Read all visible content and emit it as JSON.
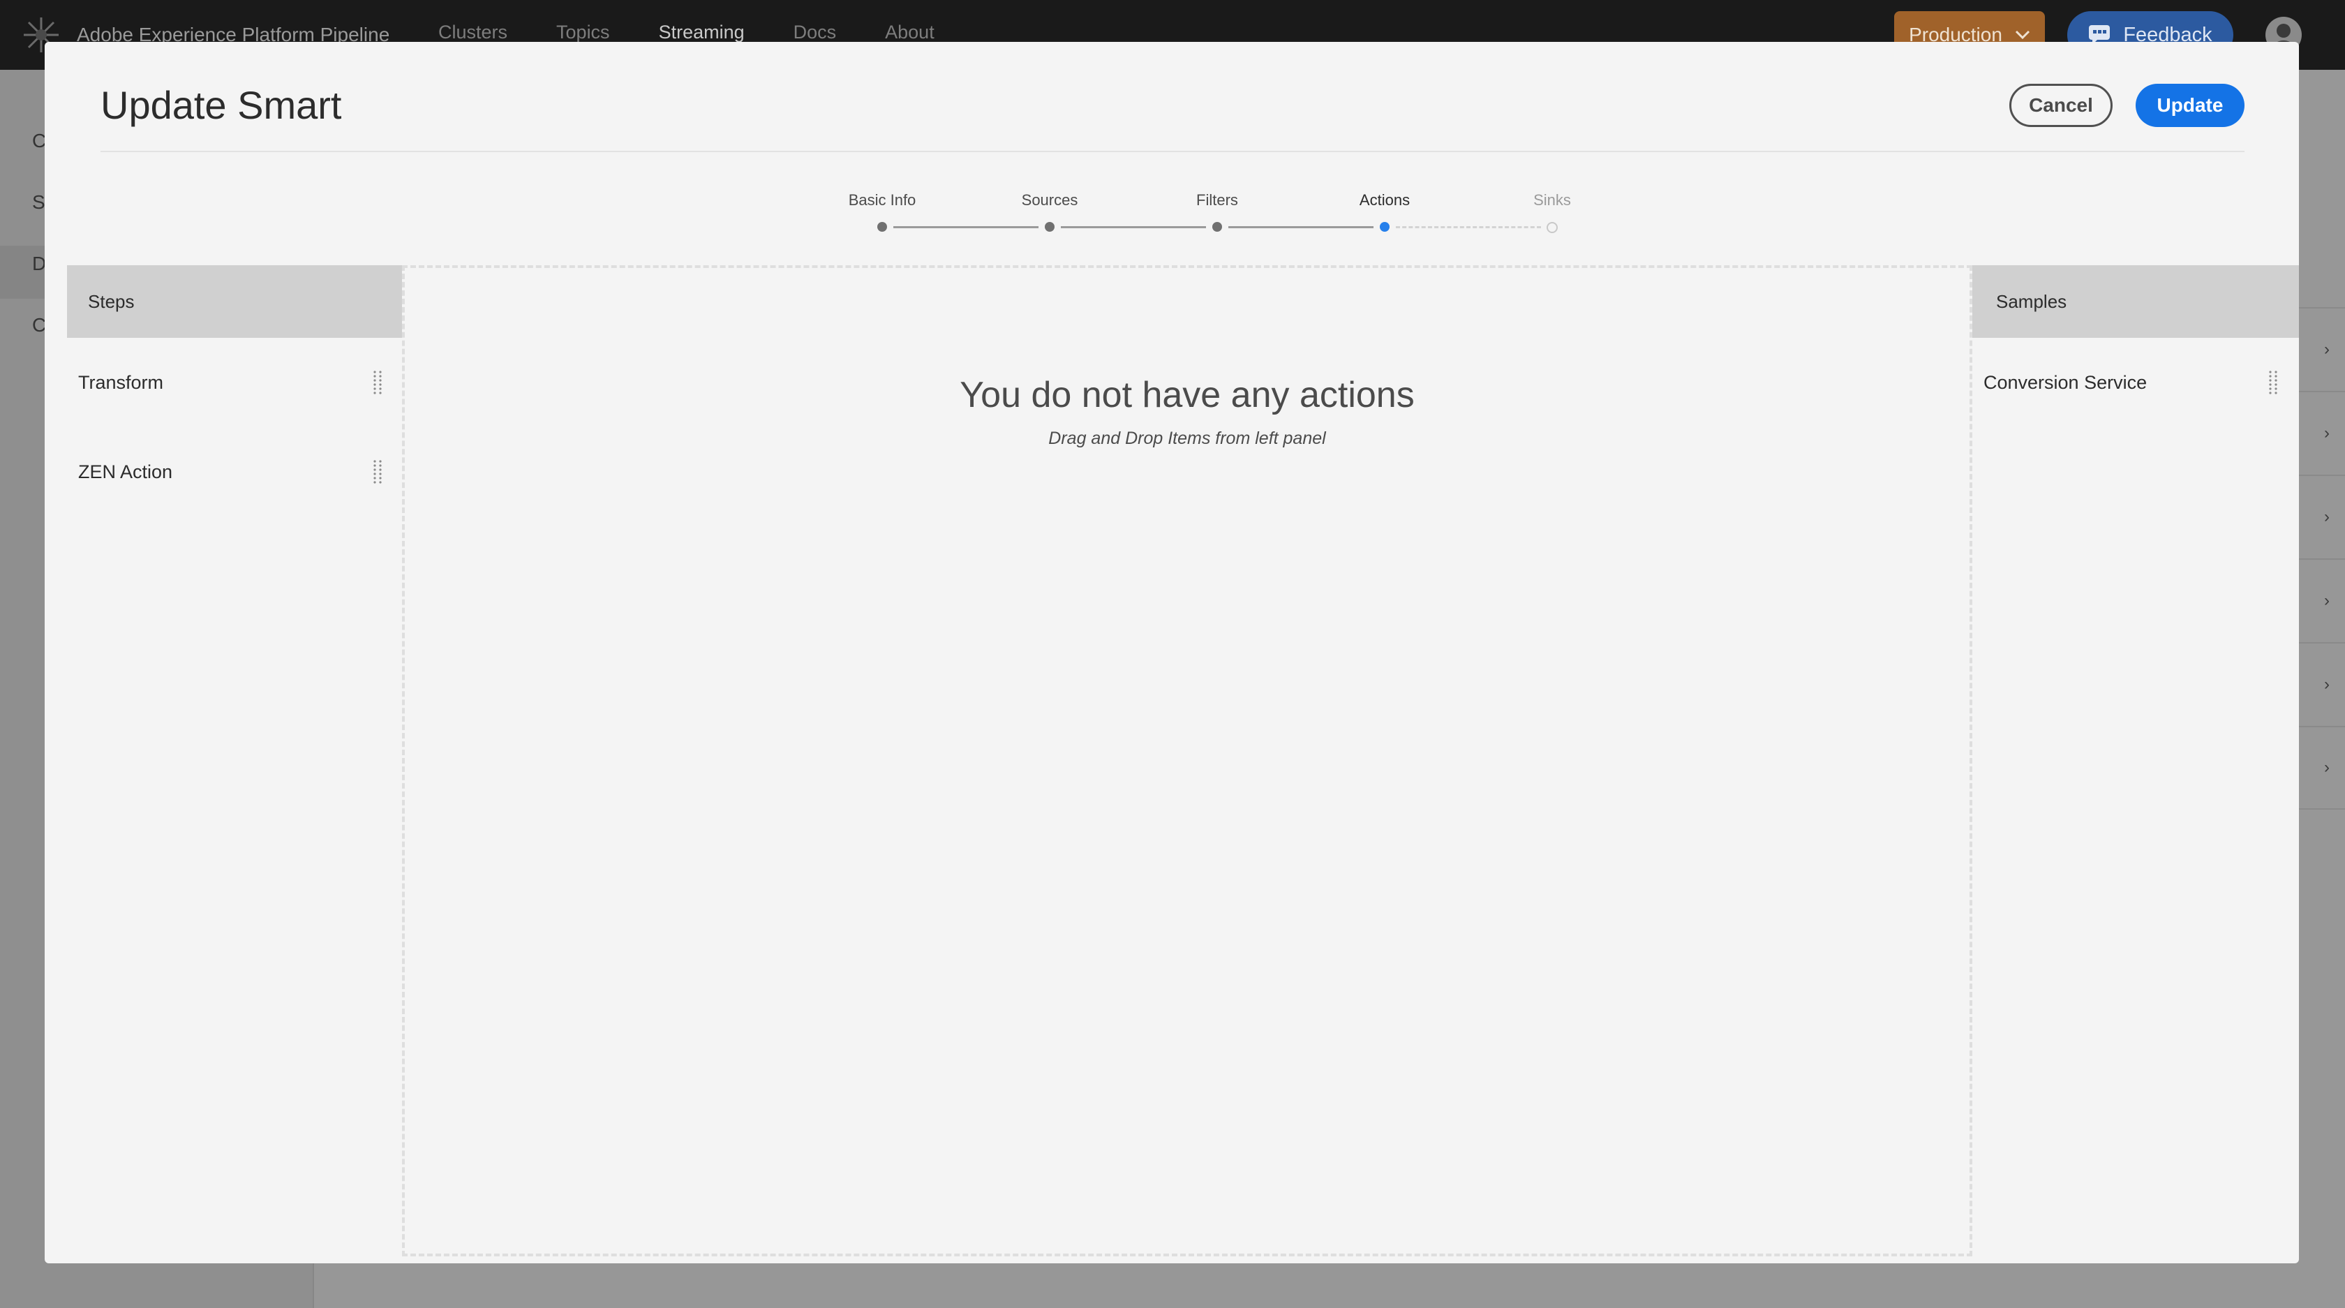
{
  "app": {
    "title": "Adobe Experience Platform Pipeline",
    "nav": [
      {
        "label": "Clusters"
      },
      {
        "label": "Topics"
      },
      {
        "label": "Streaming",
        "active": true
      },
      {
        "label": "Docs"
      },
      {
        "label": "About"
      }
    ],
    "environment_label": "Production",
    "feedback_label": "Feedback",
    "sidebar_initials": [
      "C",
      "S",
      "D",
      "C"
    ]
  },
  "modal": {
    "title": "Update Smart",
    "cancel_label": "Cancel",
    "update_label": "Update",
    "stepper": {
      "steps": [
        {
          "label": "Basic Info",
          "state": "done"
        },
        {
          "label": "Sources",
          "state": "done"
        },
        {
          "label": "Filters",
          "state": "done"
        },
        {
          "label": "Actions",
          "state": "current"
        },
        {
          "label": "Sinks",
          "state": "future"
        }
      ]
    },
    "steps_panel": {
      "heading": "Steps",
      "items": [
        {
          "label": "Transform"
        },
        {
          "label": "ZEN Action"
        }
      ]
    },
    "drop_zone": {
      "empty_title": "You do not have any actions",
      "empty_hint": "Drag and Drop Items from left panel"
    },
    "samples_panel": {
      "heading": "Samples",
      "items": [
        {
          "label": "Conversion Service"
        }
      ]
    }
  },
  "colors": {
    "accent": "#1473e6",
    "environment": "#a0622a",
    "feedback": "#2c5aa0",
    "overlay": "#979797"
  },
  "icons": {
    "brand": "adobe-pipeline-logo-icon",
    "environment_dropdown": "chevron-down-icon",
    "feedback": "chat-bubble-icon",
    "avatar": "user-avatar-icon",
    "drag": "drag-handle-icon",
    "row_expand": "chevron-right-icon"
  }
}
